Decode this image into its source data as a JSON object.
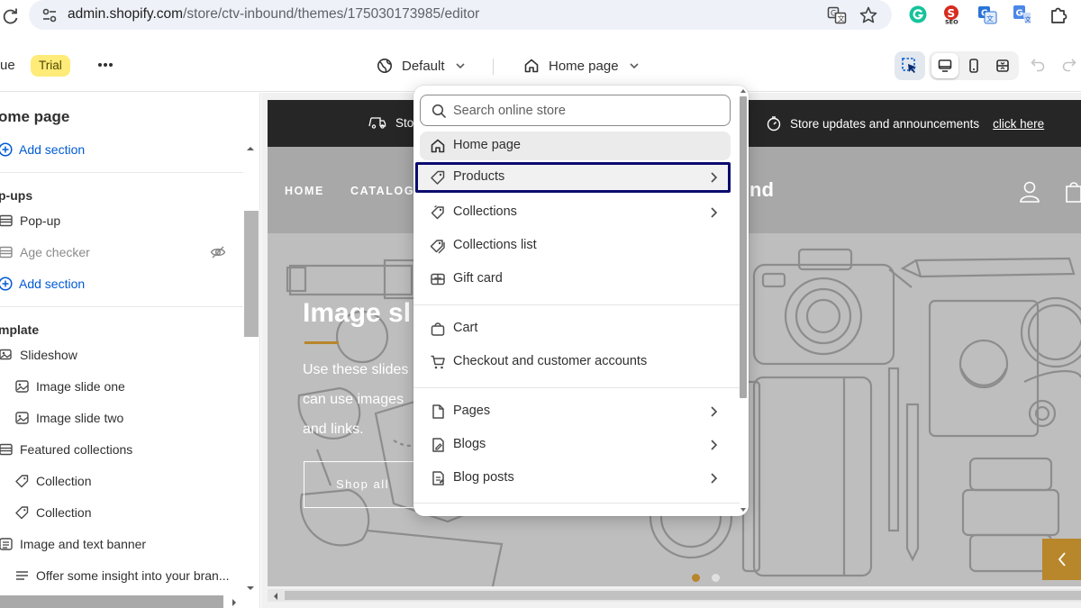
{
  "browser": {
    "url_host": "admin.shopify.com",
    "url_path": "/store/ctv-inbound/themes/175030173985/editor"
  },
  "editor": {
    "theme_name_partial": "ue",
    "trial_badge": "Trial",
    "theme_select_label": "Default",
    "page_select_label": "Home page"
  },
  "sidebar": {
    "title": "ome page",
    "add_section_label": "Add section",
    "popups_heading": "p-ups",
    "popups": [
      "Pop-up",
      "Age checker"
    ],
    "add_section_label_2": "Add section",
    "template_heading": "mplate",
    "template_items": [
      {
        "label": "Slideshow",
        "level": 0,
        "icon": "slideshow-icon"
      },
      {
        "label": "Image slide one",
        "level": 1,
        "icon": "image-icon"
      },
      {
        "label": "Image slide two",
        "level": 1,
        "icon": "image-icon"
      },
      {
        "label": "Featured collections",
        "level": 0,
        "icon": "section-icon"
      },
      {
        "label": "Collection",
        "level": 1,
        "icon": "tag-icon"
      },
      {
        "label": "Collection",
        "level": 1,
        "icon": "tag-icon"
      },
      {
        "label": "Image and text banner",
        "level": 0,
        "icon": "text-block-icon"
      },
      {
        "label": "Offer some insight into your bran...",
        "level": 1,
        "icon": "text-lines-icon"
      }
    ]
  },
  "store": {
    "announce_left": "Stor",
    "announce_right": "Store updates and announcements",
    "announce_link": "click here",
    "nav": [
      "HOME",
      "CATALOG"
    ],
    "logo_peek": "nd",
    "hero_title": "Image sl",
    "hero_lines": [
      "Use these slides",
      "can use images",
      "and links."
    ],
    "hero_button": "Shop all"
  },
  "dropdown": {
    "search_placeholder": "Search online store",
    "items": [
      {
        "label": "Home page",
        "icon": "home-icon",
        "chevron": false
      },
      {
        "label": "Products",
        "icon": "tag-icon",
        "chevron": true
      },
      {
        "label": "Collections",
        "icon": "collection-icon",
        "chevron": true
      },
      {
        "label": "Collections list",
        "icon": "collection-list-icon",
        "chevron": false
      },
      {
        "label": "Gift card",
        "icon": "gift-card-icon",
        "chevron": false
      },
      {
        "label": "Cart",
        "icon": "cart-bag-icon",
        "chevron": false
      },
      {
        "label": "Checkout and customer accounts",
        "icon": "checkout-cart-icon",
        "chevron": false
      },
      {
        "label": "Pages",
        "icon": "page-icon",
        "chevron": true
      },
      {
        "label": "Blogs",
        "icon": "blog-icon",
        "chevron": true
      },
      {
        "label": "Blog posts",
        "icon": "blog-post-icon",
        "chevron": true
      }
    ]
  },
  "colors": {
    "accent_blue": "#005bd3",
    "focus_ring": "#0b0b6e",
    "trial_badge_bg": "#ffeb78",
    "hero_gold": "#b8862b",
    "announcement_bg": "#262626"
  }
}
